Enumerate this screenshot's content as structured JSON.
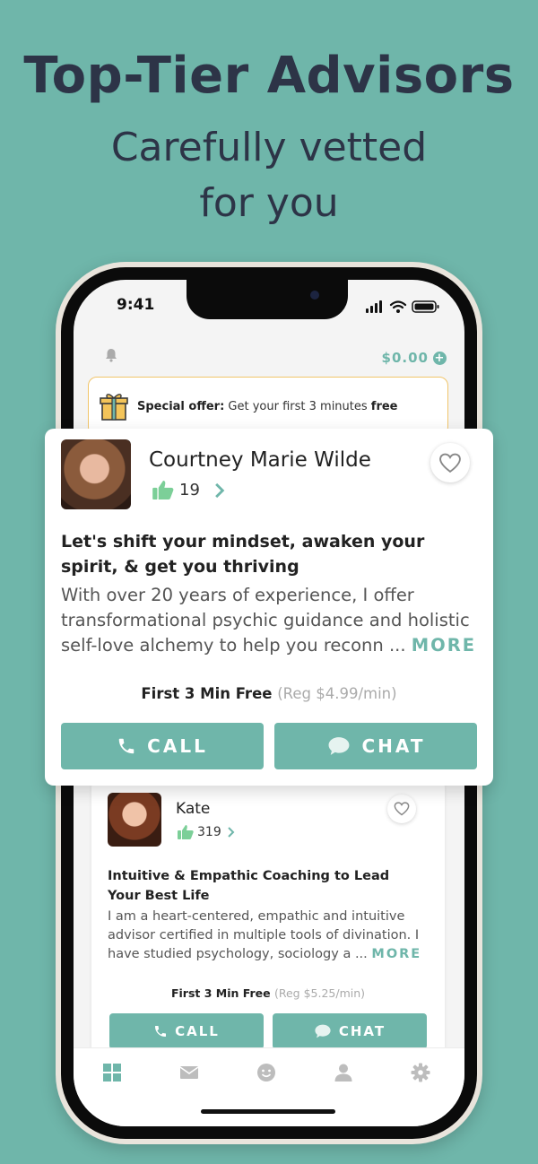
{
  "promo": {
    "headline": "Top-Tier Advisors",
    "subheadline_line1": "Carefully vetted",
    "subheadline_line2": "for you"
  },
  "status_bar": {
    "time": "9:41"
  },
  "header": {
    "balance": "$0.00"
  },
  "offer_banner": {
    "label": "Special offer:",
    "text": " Get your first 3 minutes ",
    "emphasis": "free"
  },
  "featured_advisor": {
    "name": "Courtney Marie Wilde",
    "rating_count": "19",
    "tagline": "Let's shift your mindset, awaken your spirit, & get you thriving",
    "description": "With over 20 years of experience, I offer transformational psychic guidance and holistic self-love alchemy to help you reconn ...",
    "more_label": "MORE",
    "price_offer": "First 3 Min Free",
    "price_regular": "(Reg $4.99/min)",
    "call_label": "CALL",
    "chat_label": "CHAT"
  },
  "advisor_2": {
    "name": "Kate",
    "rating_count": "319",
    "tagline": "Intuitive & Empathic Coaching to Lead Your Best Life",
    "description": "I am a heart-centered, empathic and intuitive advisor certified in multiple tools of divination. I have studied psychology, sociology a ...",
    "more_label": "MORE",
    "price_offer": "First 3 Min Free",
    "price_regular": "(Reg $5.25/min)",
    "call_label": "CALL",
    "chat_label": "CHAT"
  },
  "tab_bar": {
    "items": [
      "home",
      "messages",
      "mood",
      "profile",
      "settings"
    ],
    "active": "home"
  },
  "colors": {
    "background": "#6fb6aa",
    "accent": "#6fb6aa",
    "headline": "#2d3447",
    "offer_border": "#f1c56a",
    "thumb": "#7ccf98"
  }
}
